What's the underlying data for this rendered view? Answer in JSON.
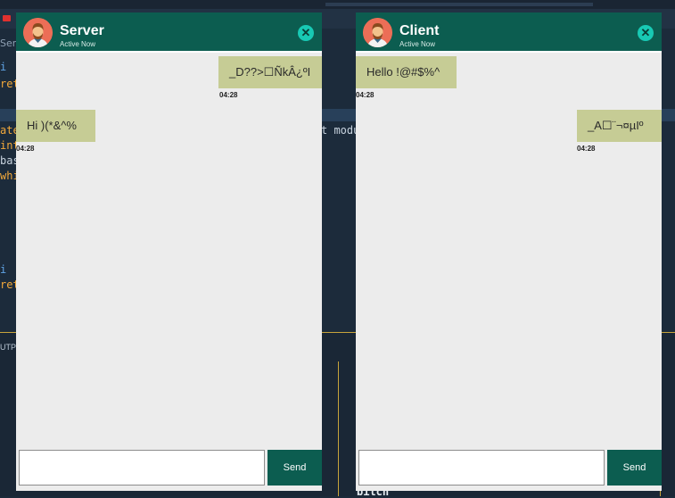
{
  "ide": {
    "breadcrumb": "Serv",
    "code_left": [
      "i",
      "ret",
      "ate",
      "int",
      "bas",
      "whi",
      "i",
      "ret"
    ],
    "code_fragment": "t modu",
    "panel_label": "UTPU",
    "terminal_text": "bitch"
  },
  "server": {
    "title": "Server",
    "status": "Active Now",
    "messages": [
      {
        "side": "right",
        "text": "_D??>☐ÑkÂ¿ºI",
        "time": "04:28"
      },
      {
        "side": "left",
        "text": "Hi )(*&^%",
        "time": "04:28"
      }
    ],
    "input_value": "",
    "send_label": "Send"
  },
  "client": {
    "title": "Client",
    "status": "Active Now",
    "messages": [
      {
        "side": "left",
        "text": "Hello !@#$%^",
        "time": "04:28"
      },
      {
        "side": "right",
        "text": "_A☐¨¬¤µIº",
        "time": "04:28"
      }
    ],
    "input_value": "",
    "send_label": "Send"
  },
  "colors": {
    "header": "#0c5d50",
    "bubble": "#c6cc95",
    "close": "#18c9b4",
    "chat_bg": "#ececec",
    "ide_bg": "#1c2b3b"
  },
  "icons": {
    "close": "close-icon",
    "avatar": "avatar-icon"
  }
}
